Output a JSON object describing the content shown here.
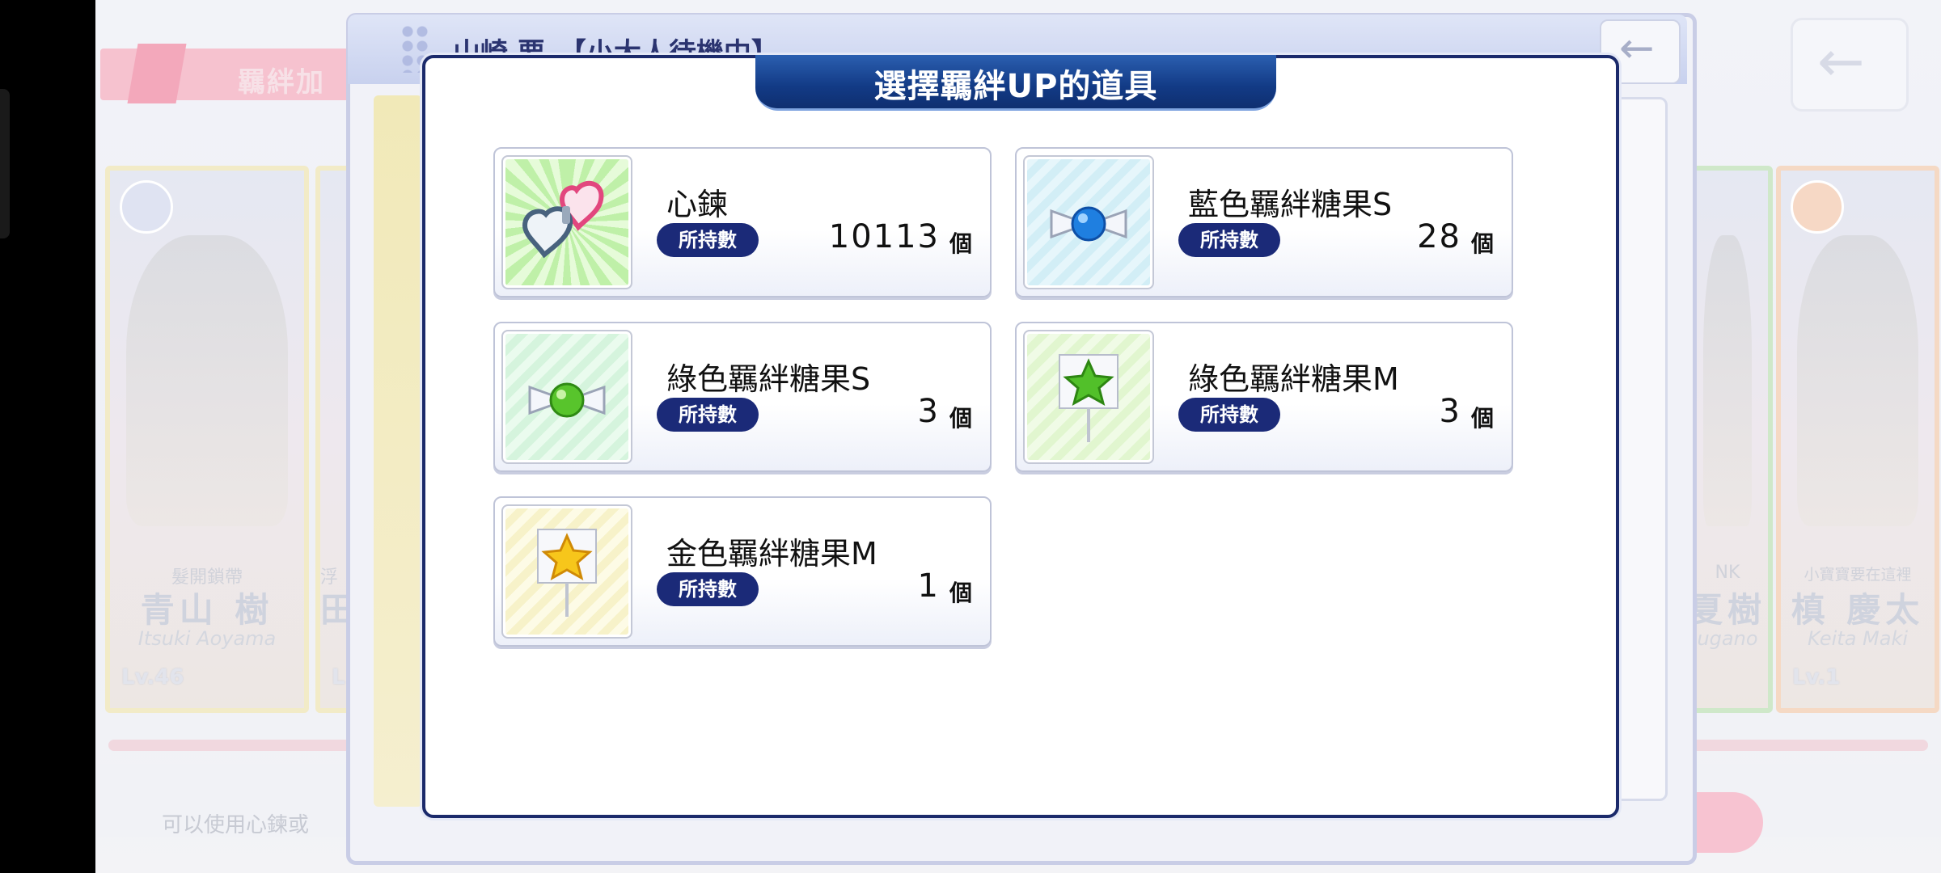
{
  "background": {
    "banner_text": "羈絆加",
    "panel_title": "山崎 要　【小大人待機中】",
    "bottom_hint": "可以使用心鍊或",
    "cards": [
      {
        "subtitle": "髮開鎖帶",
        "name": "青山 樹",
        "roman": "Itsuki Aoyama",
        "level": "Lv.46"
      },
      {
        "subtitle": "浮",
        "name": "田",
        "roman": "",
        "level": "L"
      },
      {
        "subtitle": "NK",
        "name": "夏樹",
        "roman": "ugano",
        "level": ""
      },
      {
        "subtitle": "小寶寶要在這裡",
        "name": "槙 慶太",
        "roman": "Keita Maki",
        "level": "Lv.1"
      }
    ]
  },
  "dialog": {
    "title": "選擇羈絆UP的道具",
    "held_label": "所持數",
    "unit": "個",
    "items": [
      {
        "name": "心鍊",
        "count": "10113",
        "icon": "heart-handcuffs-icon"
      },
      {
        "name": "藍色羈絆糖果S",
        "count": "28",
        "icon": "blue-candy-icon"
      },
      {
        "name": "綠色羈絆糖果S",
        "count": "3",
        "icon": "green-candy-icon"
      },
      {
        "name": "綠色羈絆糖果M",
        "count": "3",
        "icon": "green-star-lollipop-icon"
      },
      {
        "name": "金色羈絆糖果M",
        "count": "1",
        "icon": "gold-star-lollipop-icon"
      }
    ]
  },
  "colors": {
    "dialog_border": "#1b2a6b",
    "title_tab": "#123a85",
    "badge": "#1b2a78"
  }
}
